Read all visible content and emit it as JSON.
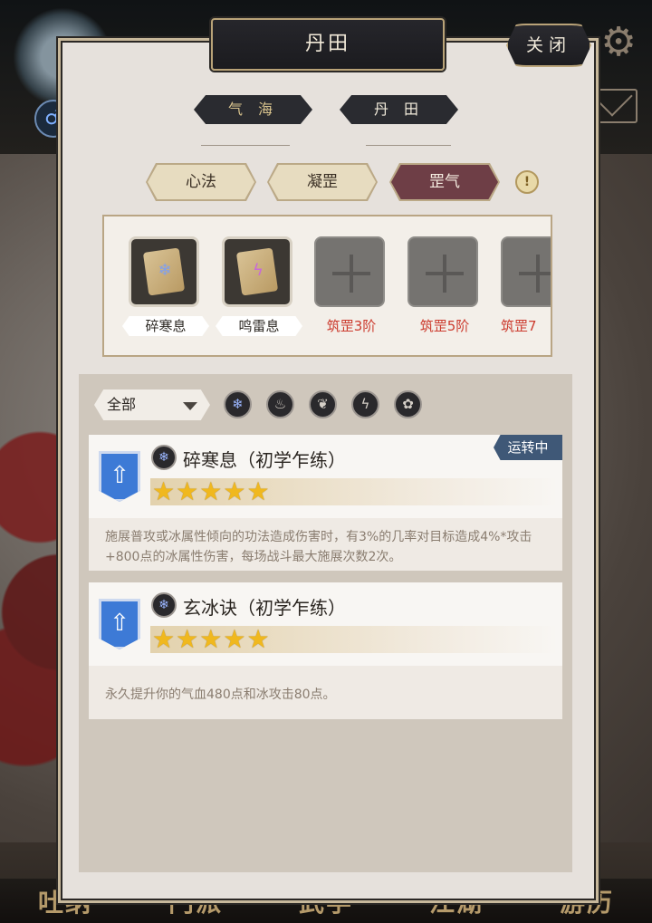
{
  "window": {
    "title": "丹田",
    "close_label": "关闭"
  },
  "mode_tabs": [
    {
      "label": "气 海",
      "active": false
    },
    {
      "label": "丹 田",
      "active": true
    }
  ],
  "tabs": [
    {
      "label": "心法",
      "active": false
    },
    {
      "label": "凝罡",
      "active": false
    },
    {
      "label": "罡气",
      "active": true
    }
  ],
  "info_icon": "!",
  "slots": [
    {
      "type": "book",
      "gem_icon": "ice-gem-icon",
      "label": "碎寒息"
    },
    {
      "type": "book",
      "gem_icon": "thunder-gem-icon",
      "label": "鸣雷息"
    },
    {
      "type": "empty",
      "label": "筑罡3阶"
    },
    {
      "type": "empty",
      "label": "筑罡5阶"
    },
    {
      "type": "empty",
      "label": "筑罡7"
    }
  ],
  "filter": {
    "selected": "全部",
    "elements": [
      "ice-icon",
      "fire-icon",
      "wood-icon",
      "thunder-icon",
      "lotus-icon"
    ]
  },
  "skills": [
    {
      "name": "碎寒息（初学乍练）",
      "stars": 5,
      "running_label": "运转中",
      "description": "施展普攻或冰属性倾向的功法造成伤害时，有3%的几率对目标造成4%*攻击+800点的冰属性伤害，每场战斗最大施展次数2次。"
    },
    {
      "name": "玄冰诀（初学乍练）",
      "stars": 5,
      "running_label": "",
      "description": "永久提升你的气血480点和冰攻击80点。"
    }
  ],
  "bottom_nav": [
    "吐纳",
    "门派",
    "武学",
    "江湖",
    "游历"
  ],
  "colors": {
    "accent": "#6e3e46",
    "locked_text": "#cc3b2e",
    "running_badge": "#3f5877",
    "star": "#f0b81e"
  }
}
